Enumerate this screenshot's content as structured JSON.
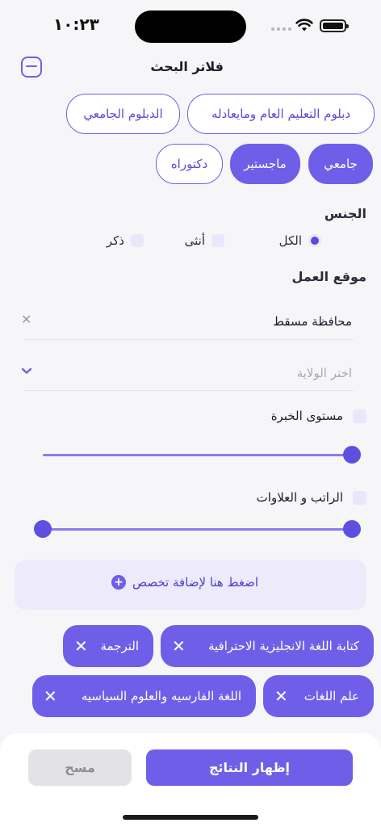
{
  "status_bar": {
    "time": "١٠:٢٣"
  },
  "header": {
    "title": "فلاتر البحث"
  },
  "education": {
    "chips": [
      {
        "label": "دبلوم التعليم العام ومايعادله",
        "selected": false
      },
      {
        "label": "الدبلوم الجامعي",
        "selected": false
      },
      {
        "label": "جامعي",
        "selected": true
      },
      {
        "label": "ماجستير",
        "selected": true
      },
      {
        "label": "دكتوراه",
        "selected": false
      }
    ]
  },
  "gender": {
    "title": "الجنس",
    "options": [
      {
        "label": "الكل",
        "selected": true
      },
      {
        "label": "أنثى",
        "selected": false
      },
      {
        "label": "ذكر",
        "selected": false
      }
    ]
  },
  "location": {
    "title": "موقع العمل",
    "governorate_value": "محافظة مسقط",
    "wilayat_placeholder": "اختر الولاية"
  },
  "experience": {
    "label": "مستوى الخبرة",
    "checked": false,
    "slider_value": 1.0
  },
  "salary": {
    "label": "الراتب و العلاوات",
    "checked": false,
    "range_min": 0.0,
    "range_max": 1.0
  },
  "specialty": {
    "add_label": "اضغط هنا لإضافة تخصص",
    "tags": [
      "كتابة اللغة الانجليزية الاحترافية",
      "الترجمة",
      "علم اللغات",
      "اللغة الفارسيه والعلوم السياسيه"
    ]
  },
  "footer": {
    "show_results": "إظهار النتائج",
    "clear": "مسح"
  },
  "colors": {
    "accent": "#6f5fe8",
    "accent_light": "#eceafb"
  },
  "icons": [
    "collapse-icon",
    "clear-icon",
    "chevron-down-icon",
    "plus-circle-icon",
    "remove-tag-icon",
    "wifi-icon",
    "battery-icon"
  ]
}
